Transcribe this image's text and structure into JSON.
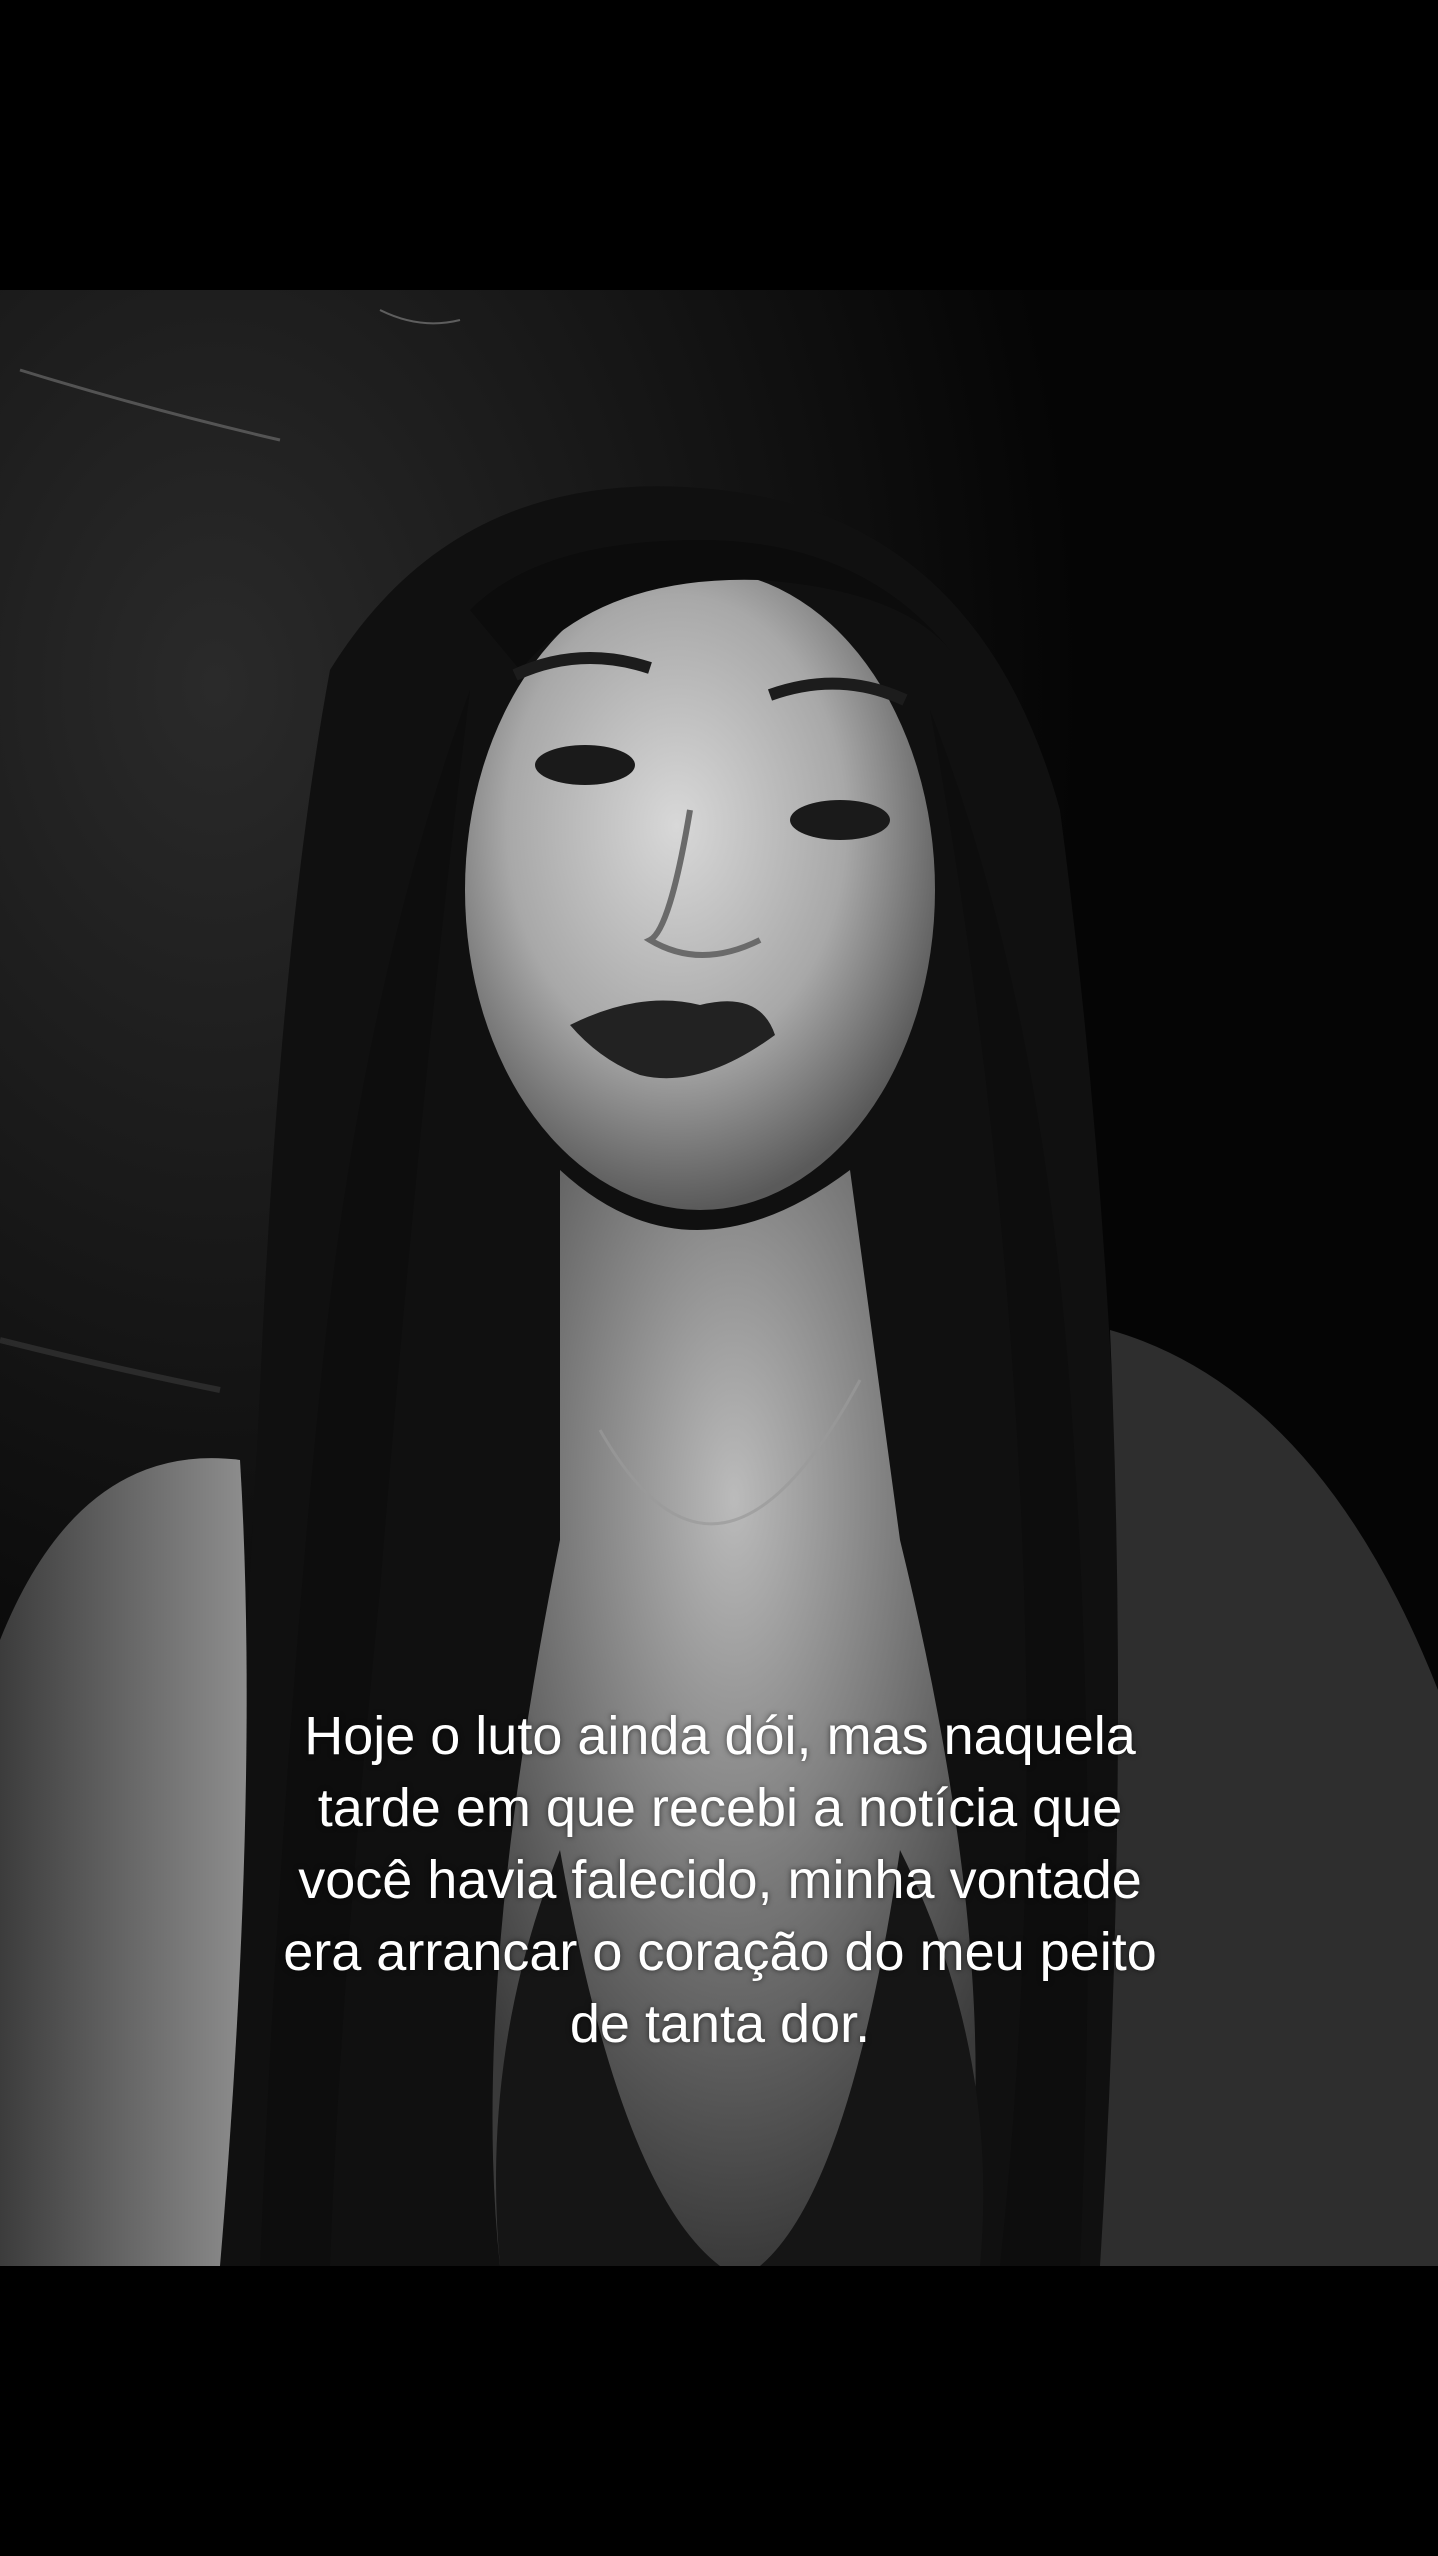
{
  "caption": {
    "lines": [
      "Hoje o luto ainda dói, mas naquela",
      "tarde em que recebi a notícia que",
      "você havia falecido, minha vontade",
      "era arrancar o coração do meu peito",
      "de tanta dor."
    ]
  },
  "photo": {
    "description_icon": "portrait-photo-icon",
    "palette": {
      "background": "#000000",
      "skin": "#bdbdbd",
      "hair": "#111111"
    }
  }
}
